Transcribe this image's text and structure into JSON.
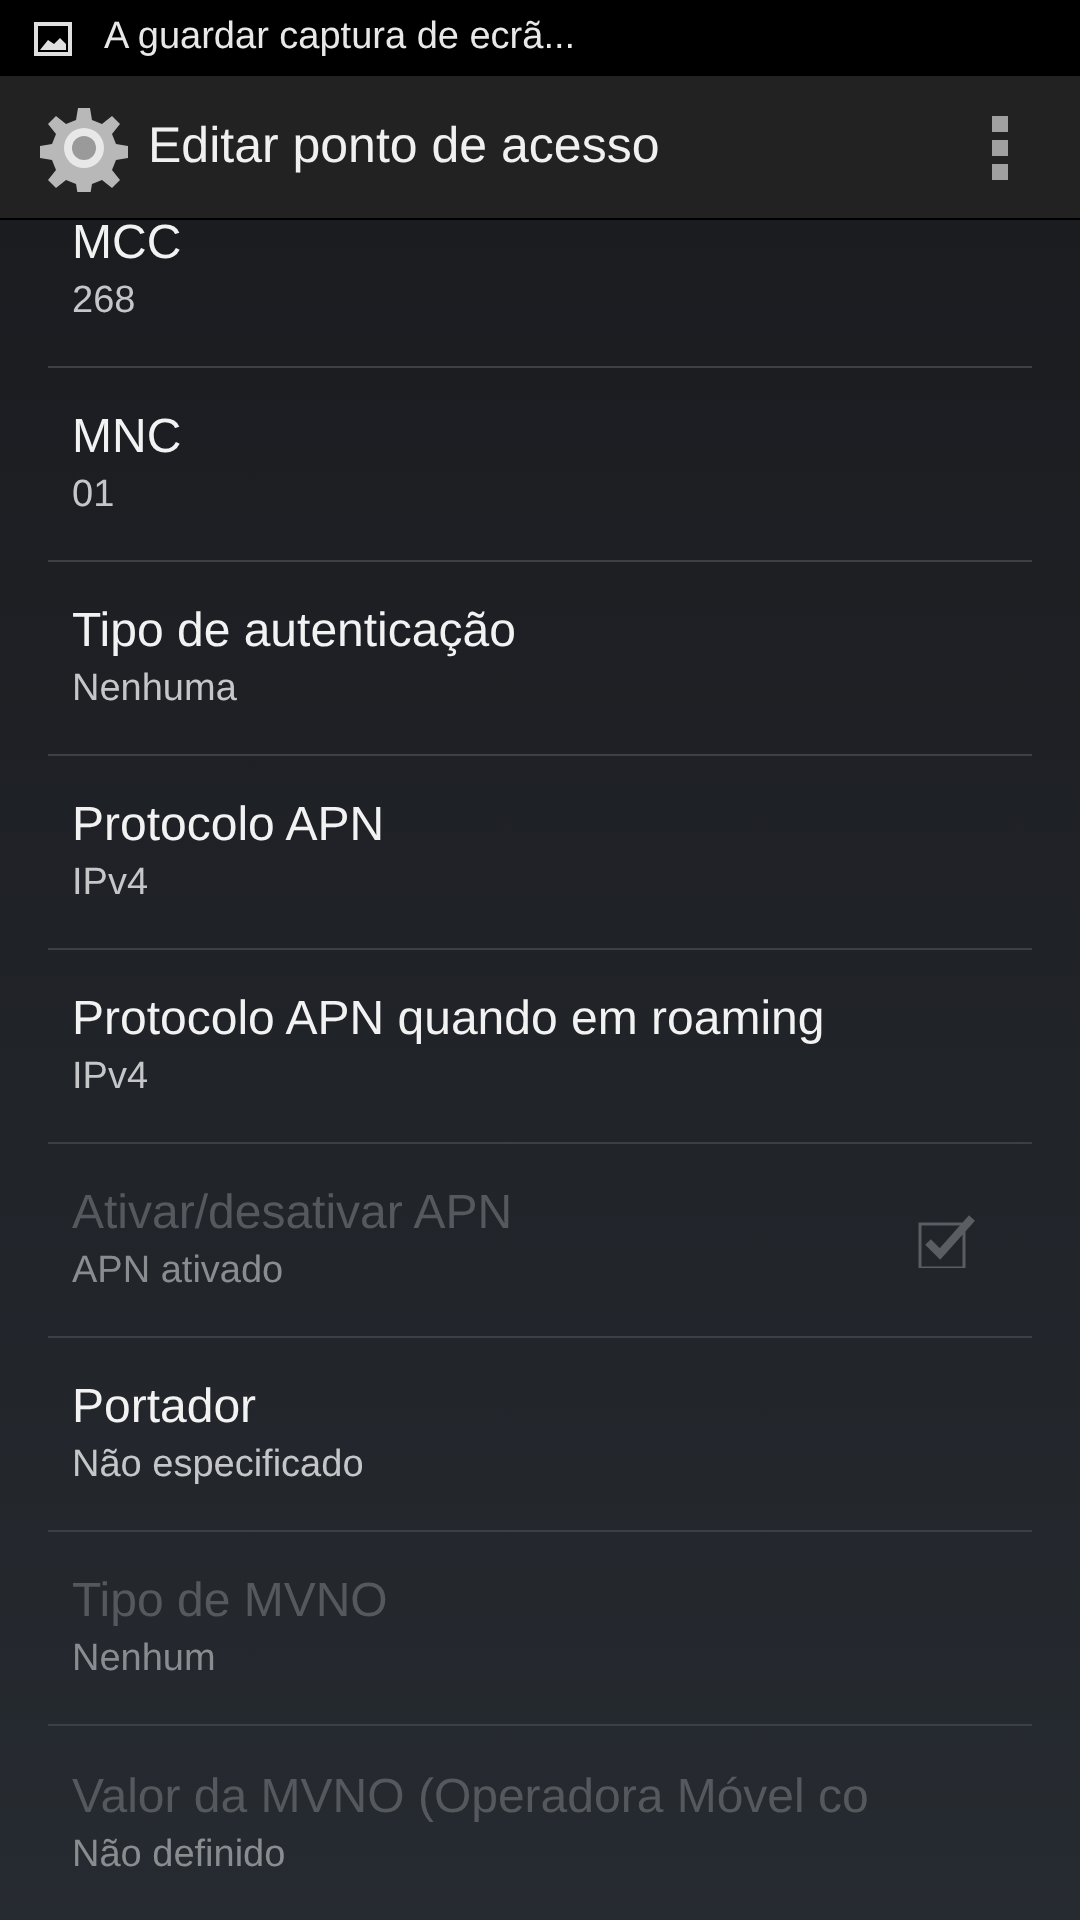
{
  "status_bar": {
    "notification": "A guardar captura de ecrã..."
  },
  "action_bar": {
    "title": "Editar ponto de acesso"
  },
  "items": [
    {
      "kind": "text",
      "title": "MCC",
      "summary": "268",
      "disabled": false
    },
    {
      "kind": "text",
      "title": "MNC",
      "summary": "01",
      "disabled": false
    },
    {
      "kind": "text",
      "title": "Tipo de autenticação",
      "summary": "Nenhuma",
      "disabled": false
    },
    {
      "kind": "text",
      "title": "Protocolo APN",
      "summary": "IPv4",
      "disabled": false
    },
    {
      "kind": "text",
      "title": "Protocolo APN quando em roaming",
      "summary": "IPv4",
      "disabled": false
    },
    {
      "kind": "checkbox",
      "title": "Ativar/desativar APN",
      "summary": "APN ativado",
      "disabled": true,
      "checked": true
    },
    {
      "kind": "text",
      "title": "Portador",
      "summary": "Não especificado",
      "disabled": false
    },
    {
      "kind": "text",
      "title": "Tipo de MVNO",
      "summary": "Nenhum",
      "disabled": true
    },
    {
      "kind": "text",
      "title": "Valor da MVNO (Operadora Móvel co",
      "summary": "Não definido",
      "disabled": true
    }
  ]
}
